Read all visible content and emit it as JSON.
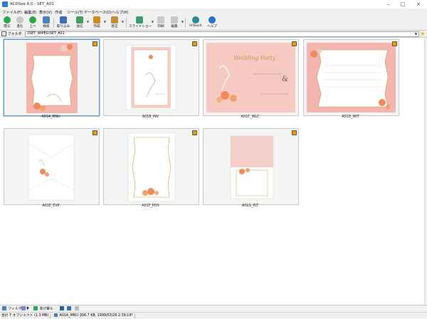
{
  "window": {
    "title": "ACDSee 6.0 - SET_A01"
  },
  "menubar": [
    {
      "label": "ファイル(F)"
    },
    {
      "label": "編集(E)"
    },
    {
      "label": "表示(V)"
    },
    {
      "label": "作成"
    },
    {
      "label": "ツール(T)"
    },
    {
      "label": "データベース(D)"
    },
    {
      "label": "ヘルプ(H)"
    }
  ],
  "toolbar": [
    {
      "label": "閉る",
      "icon": "back-icon",
      "color": "#2aa84a"
    },
    {
      "label": "進む",
      "icon": "forward-icon",
      "color": "#bdbdbd"
    },
    {
      "label": "上へ",
      "icon": "up-icon",
      "color": "#2aa84a"
    },
    {
      "label": "検索",
      "icon": "search-icon",
      "color": "#4a7fc0"
    },
    {
      "label": "取り込み",
      "icon": "import-icon",
      "color": "#3a6fb8"
    },
    {
      "label": "送信",
      "icon": "send-icon",
      "color": "#3aa060"
    },
    {
      "label": "作成",
      "icon": "create-icon",
      "color": "#d08a20"
    },
    {
      "label": "修正",
      "icon": "edit-icon",
      "color": "#c09030"
    },
    {
      "label": "スライドショー",
      "icon": "slideshow-icon",
      "color": "#3a9a70"
    },
    {
      "label": "印刷",
      "icon": "print-icon",
      "color": "#bdbdbd"
    },
    {
      "label": "編集",
      "icon": "photo-edit-icon",
      "color": "#bdbdbd"
    },
    {
      "label": "InTouch",
      "icon": "intouch-icon",
      "color": "#2a8a9a"
    },
    {
      "label": "ヘルプ",
      "icon": "help-icon",
      "color": "#2a70c8"
    }
  ],
  "address": {
    "folder_label": "フォルダ",
    "path": "2SET_WIPEG\\SET_A01"
  },
  "thumbnails": [
    {
      "name": "A01A_MNU",
      "kind": "menu-card",
      "selected": true
    },
    {
      "name": "A01B_INV",
      "kind": "invitation"
    },
    {
      "name": "A01C_WLC",
      "kind": "welcome"
    },
    {
      "name": "A01D_WIT",
      "kind": "witness"
    },
    {
      "name": "A01E_EVP",
      "kind": "envelope"
    },
    {
      "name": "A01F_POS",
      "kind": "poster"
    },
    {
      "name": "A01G_PLT",
      "kind": "place-card"
    }
  ],
  "welcome_script": "Wedding Party",
  "welcome_amp": "&",
  "statusbar_tools": {
    "filter": "フィルタ",
    "sort": "並び替え"
  },
  "status": {
    "total": "合計 7 オブジェクト (1.3 MB)",
    "selected": "A01A_MNU",
    "info": "306.7 KB, 1999/03/26 2:39:19*"
  },
  "colors": {
    "pink": "#f2b6ae",
    "pink_light": "#f6c9c2",
    "gold": "#c89a50",
    "flower": "#f08a5a",
    "select": "#5b9bd5"
  }
}
